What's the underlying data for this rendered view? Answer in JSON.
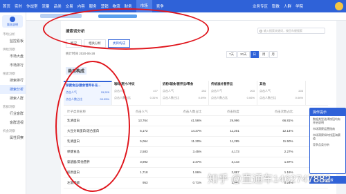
{
  "topnav": {
    "items": [
      "首页",
      "实时",
      "作战室",
      "流量",
      "品类",
      "交易",
      "内容",
      "服务",
      "营销",
      "物流",
      "财务",
      "市场",
      "竞争"
    ],
    "active": "市场",
    "right": [
      "业务专区",
      "取数",
      "人群",
      "学院"
    ]
  },
  "logo": "版本说明",
  "sidebar": [
    {
      "type": "group",
      "label": "市场分析"
    },
    {
      "type": "link",
      "label": "监控看板"
    },
    {
      "type": "group",
      "label": "供给洞察"
    },
    {
      "type": "link",
      "label": "市场大盘"
    },
    {
      "type": "link",
      "label": "市场排行"
    },
    {
      "type": "group",
      "label": "搜索洞察"
    },
    {
      "type": "link",
      "label": "搜索排行"
    },
    {
      "type": "link",
      "label": "搜索分析",
      "active": true
    },
    {
      "type": "link",
      "label": "搜索人群"
    },
    {
      "type": "group",
      "label": "客群洞察"
    },
    {
      "type": "link",
      "label": "行业客群"
    },
    {
      "type": "link",
      "label": "客群透视"
    },
    {
      "type": "group",
      "label": "机会洞察"
    },
    {
      "type": "link",
      "label": "属性洞察"
    }
  ],
  "panel": {
    "title": "搜索词分析",
    "search_placeholder": "输入搜索关键词，按回车键搜索",
    "tabs": [
      "概况",
      "相关分析",
      "类目构成"
    ],
    "active_tab": "类目构成",
    "stat_time": "统计时间 2020-06-28",
    "periods": [
      "7天",
      "30天",
      "日",
      "周",
      "月"
    ],
    "active_period": "日",
    "section": "类目构成"
  },
  "cards": [
    {
      "name": "保健食品/膳食营养补充...",
      "a_label": "点击人气",
      "a_val": "15,529",
      "b_label": "点击人数占比",
      "b_val": "99.05%",
      "active": true
    },
    {
      "name": "咖啡/麦片/冲饮",
      "a_label": "点击人气",
      "a_val": "477",
      "b_label": "点击人数占比",
      "b_val": "0.31%"
    },
    {
      "name": "奶粉/辅食/营养品/零食",
      "a_label": "点击人气",
      "a_val": "252",
      "b_label": "点击人数占比",
      "b_val": "0.09%"
    },
    {
      "name": "传统滋补营养品",
      "a_label": "点击人气",
      "a_val": "203",
      "b_label": "点击人数占比",
      "b_val": "0.06%"
    },
    {
      "name": "其他",
      "a_label": "点击人气",
      "a_val": "203",
      "b_label": "点击人数占比",
      "b_val": "0.06%"
    }
  ],
  "table": {
    "headers": [
      "叶子类目名称",
      "点击人气",
      "点击人数占比",
      "点击热度",
      "点击次数占比",
      "点击率"
    ],
    "rows": [
      [
        "乳清蛋白",
        "13,764",
        "41.56%",
        "29,996",
        "66.81%",
        "53.10%"
      ],
      [
        "大豆分离蛋白/混合蛋白",
        "5,172",
        "14.37%",
        "11,201",
        "12.14%",
        "45.38%"
      ],
      [
        "乳清蛋白",
        "5,064",
        "11.20%",
        "11,285",
        "11.50%",
        "45.06%"
      ],
      [
        "保健食品",
        "2,583",
        "3.45%",
        "4,173",
        "2.27%",
        "11.51%"
      ],
      [
        "氨基酸/其他营养",
        "3,992",
        "2.37%",
        "3,143",
        "1.87%",
        "11.81%"
      ],
      [
        "胶原蛋白",
        "1,718",
        "1.86%",
        "2,887",
        "1.16%",
        "1.80%"
      ],
      [
        "左旋肉碱",
        "953",
        "0.71%",
        "1,994",
        "0.24%",
        "0.55%"
      ]
    ]
  },
  "helper": {
    "title": "操作提示",
    "lines": [
      "数据类型选择按钮均有开启说明",
      "市场洞察运营指南",
      "市场洞察如何找蓝海赛道",
      "竞争品类分析"
    ]
  },
  "helper_button": "在线客服",
  "watermark": "知乎 @直通车1462747882"
}
